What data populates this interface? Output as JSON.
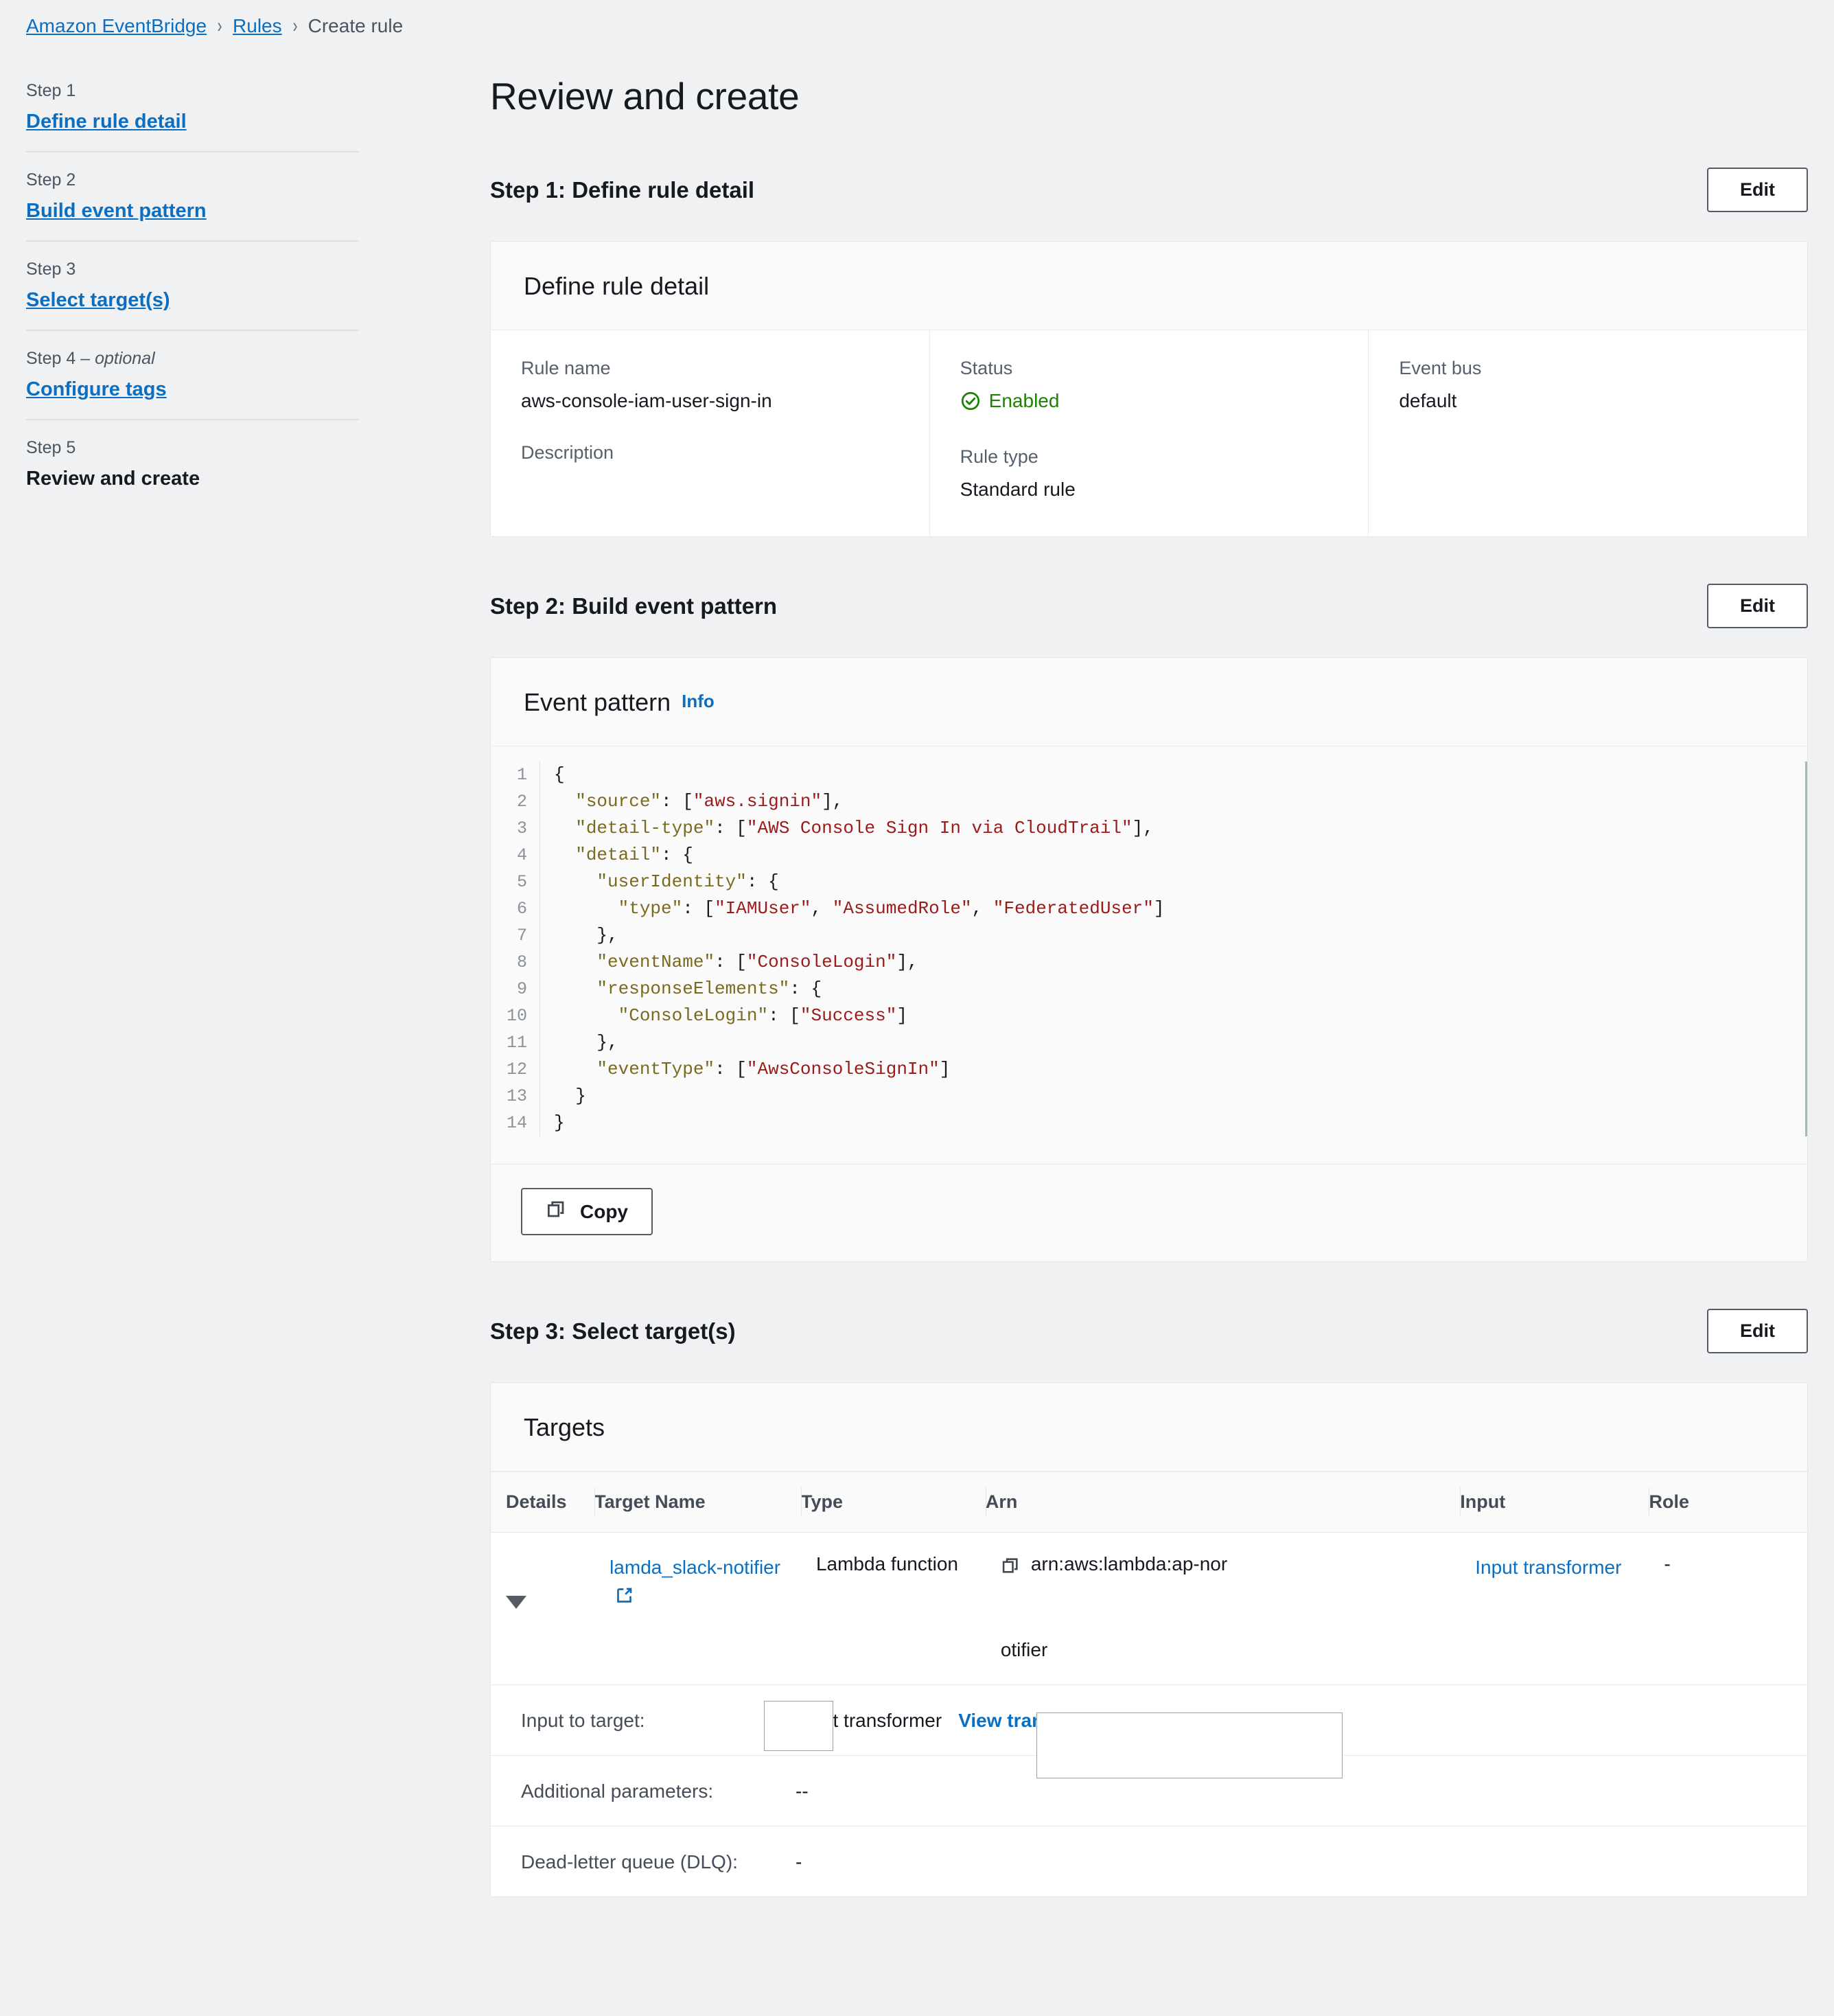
{
  "breadcrumb": {
    "items": [
      {
        "label": "Amazon EventBridge",
        "type": "link"
      },
      {
        "label": "Rules",
        "type": "link"
      },
      {
        "label": "Create rule",
        "type": "current"
      }
    ],
    "separator": "›"
  },
  "sidebar": {
    "steps": [
      {
        "kicker": "Step 1",
        "optional": "",
        "label": "Define rule detail",
        "current": false
      },
      {
        "kicker": "Step 2",
        "optional": "",
        "label": "Build event pattern",
        "current": false
      },
      {
        "kicker": "Step 3",
        "optional": "",
        "label": "Select target(s)",
        "current": false
      },
      {
        "kicker": "Step 4",
        "optional": "optional",
        "label": "Configure tags",
        "current": false
      },
      {
        "kicker": "Step 5",
        "optional": "",
        "label": "Review and create",
        "current": true
      }
    ]
  },
  "page": {
    "title": "Review and create"
  },
  "step1": {
    "heading": "Step 1: Define rule detail",
    "edit_label": "Edit",
    "card_title": "Define rule detail",
    "fields": {
      "rule_name_label": "Rule name",
      "rule_name_value": "aws-console-iam-user-sign-in",
      "description_label": "Description",
      "description_value": "",
      "status_label": "Status",
      "status_value": "Enabled",
      "status_color": "#1d8102",
      "rule_type_label": "Rule type",
      "rule_type_value": "Standard rule",
      "event_bus_label": "Event bus",
      "event_bus_value": "default"
    }
  },
  "step2": {
    "heading": "Step 2: Build event pattern",
    "edit_label": "Edit",
    "card_title": "Event pattern",
    "info_label": "Info",
    "copy_label": "Copy",
    "code_lines": [
      {
        "n": "1",
        "text": "{"
      },
      {
        "n": "2",
        "text": "  \"source\": [\"aws.signin\"],"
      },
      {
        "n": "3",
        "text": "  \"detail-type\": [\"AWS Console Sign In via CloudTrail\"],"
      },
      {
        "n": "4",
        "text": "  \"detail\": {"
      },
      {
        "n": "5",
        "text": "    \"userIdentity\": {"
      },
      {
        "n": "6",
        "text": "      \"type\": [\"IAMUser\", \"AssumedRole\", \"FederatedUser\"]"
      },
      {
        "n": "7",
        "text": "    },"
      },
      {
        "n": "8",
        "text": "    \"eventName\": [\"ConsoleLogin\"],"
      },
      {
        "n": "9",
        "text": "    \"responseElements\": {"
      },
      {
        "n": "10",
        "text": "      \"ConsoleLogin\": [\"Success\"]"
      },
      {
        "n": "11",
        "text": "    },"
      },
      {
        "n": "12",
        "text": "    \"eventType\": [\"AwsConsoleSignIn\"]"
      },
      {
        "n": "13",
        "text": "  }"
      },
      {
        "n": "14",
        "text": "}"
      }
    ]
  },
  "step3": {
    "heading": "Step 3: Select target(s)",
    "edit_label": "Edit",
    "card_title": "Targets",
    "columns": [
      "Details",
      "Target Name",
      "Type",
      "Arn",
      "Input",
      "Role"
    ],
    "rows": [
      {
        "target_name": "lamda_slack-notifier",
        "type": "Lambda function",
        "arn": "arn:aws:lambda:ap-nor",
        "arn_overflow": "otifier",
        "input": "Input transformer",
        "role": "-"
      }
    ],
    "detail_rows": [
      {
        "key": "Input to target:",
        "value": "Input transformer",
        "link": "View transformer"
      },
      {
        "key": "Additional parameters:",
        "value": "--",
        "link": ""
      },
      {
        "key": "Dead-letter queue (DLQ):",
        "value": "-",
        "link": ""
      }
    ]
  }
}
